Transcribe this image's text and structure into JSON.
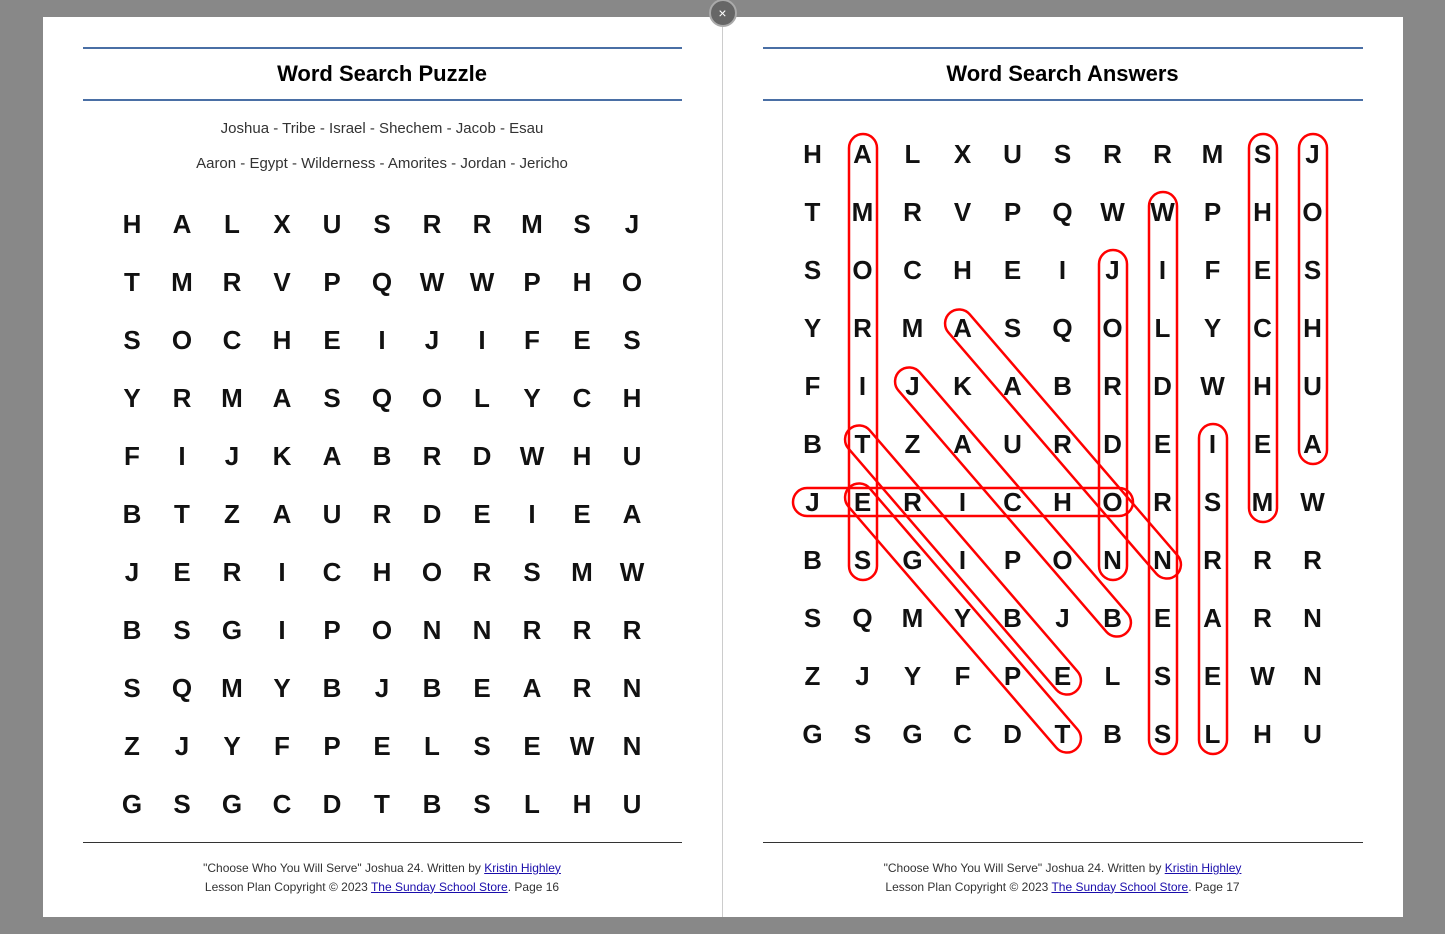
{
  "close_label": "×",
  "left_page": {
    "title": "Word Search Puzzle",
    "word_list_1": "Joshua - Tribe - Israel - Shechem - Jacob - Esau",
    "word_list_2": "Aaron - Egypt - Wilderness - Amorites - Jordan - Jericho",
    "grid": [
      [
        "H",
        "A",
        "L",
        "X",
        "U",
        "S",
        "R",
        "R",
        "M",
        "S",
        "J"
      ],
      [
        "T",
        "M",
        "R",
        "V",
        "P",
        "Q",
        "W",
        "W",
        "P",
        "H",
        "O"
      ],
      [
        "S",
        "O",
        "C",
        "H",
        "E",
        "I",
        "J",
        "I",
        "F",
        "E",
        "S"
      ],
      [
        "Y",
        "R",
        "M",
        "A",
        "S",
        "Q",
        "O",
        "L",
        "Y",
        "C",
        "H"
      ],
      [
        "F",
        "I",
        "J",
        "K",
        "A",
        "B",
        "R",
        "D",
        "W",
        "H",
        "U"
      ],
      [
        "B",
        "T",
        "Z",
        "A",
        "U",
        "R",
        "D",
        "E",
        "I",
        "E",
        "A"
      ],
      [
        "J",
        "E",
        "R",
        "I",
        "C",
        "H",
        "O",
        "R",
        "S",
        "M",
        "W"
      ],
      [
        "B",
        "S",
        "G",
        "I",
        "P",
        "O",
        "N",
        "N",
        "R",
        "R",
        "R"
      ],
      [
        "S",
        "Q",
        "M",
        "Y",
        "B",
        "J",
        "B",
        "E",
        "A",
        "R",
        "N"
      ],
      [
        "Z",
        "J",
        "Y",
        "F",
        "P",
        "E",
        "L",
        "S",
        "E",
        "W",
        "N"
      ],
      [
        "G",
        "S",
        "G",
        "C",
        "D",
        "T",
        "B",
        "S",
        "L",
        "H",
        "U"
      ]
    ],
    "footer_line1": "\"Choose Who You Will Serve\" Joshua 24.  Written by ",
    "footer_author": "Kristin Highley",
    "footer_line2": "Lesson Plan Copyright © 2023 ",
    "footer_store": "The Sunday School Store",
    "footer_page": ". Page 16"
  },
  "right_page": {
    "title": "Word Search Answers",
    "grid": [
      [
        "H",
        "A",
        "L",
        "X",
        "U",
        "S",
        "R",
        "R",
        "M",
        "S",
        "J"
      ],
      [
        "T",
        "M",
        "R",
        "V",
        "P",
        "Q",
        "W",
        "W",
        "P",
        "H",
        "O"
      ],
      [
        "S",
        "O",
        "C",
        "H",
        "E",
        "I",
        "J",
        "I",
        "F",
        "E",
        "S"
      ],
      [
        "Y",
        "R",
        "M",
        "A",
        "S",
        "Q",
        "O",
        "L",
        "Y",
        "C",
        "H"
      ],
      [
        "F",
        "I",
        "J",
        "K",
        "A",
        "B",
        "R",
        "D",
        "W",
        "H",
        "U"
      ],
      [
        "B",
        "T",
        "Z",
        "A",
        "U",
        "R",
        "D",
        "E",
        "I",
        "E",
        "A"
      ],
      [
        "J",
        "E",
        "R",
        "I",
        "C",
        "H",
        "O",
        "R",
        "S",
        "M",
        "W"
      ],
      [
        "B",
        "S",
        "G",
        "I",
        "P",
        "O",
        "N",
        "N",
        "R",
        "R",
        "R"
      ],
      [
        "S",
        "Q",
        "M",
        "Y",
        "B",
        "J",
        "B",
        "E",
        "A",
        "R",
        "N"
      ],
      [
        "Z",
        "J",
        "Y",
        "F",
        "P",
        "E",
        "L",
        "S",
        "E",
        "W",
        "N"
      ],
      [
        "G",
        "S",
        "G",
        "C",
        "D",
        "T",
        "B",
        "S",
        "L",
        "H",
        "U"
      ]
    ],
    "footer_line1": "\"Choose Who You Will Serve\" Joshua 24.  Written by ",
    "footer_author": "Kristin Highley",
    "footer_line2": "Lesson Plan Copyright © 2023 ",
    "footer_store": "The Sunday School Store",
    "footer_page": ". Page 17"
  }
}
